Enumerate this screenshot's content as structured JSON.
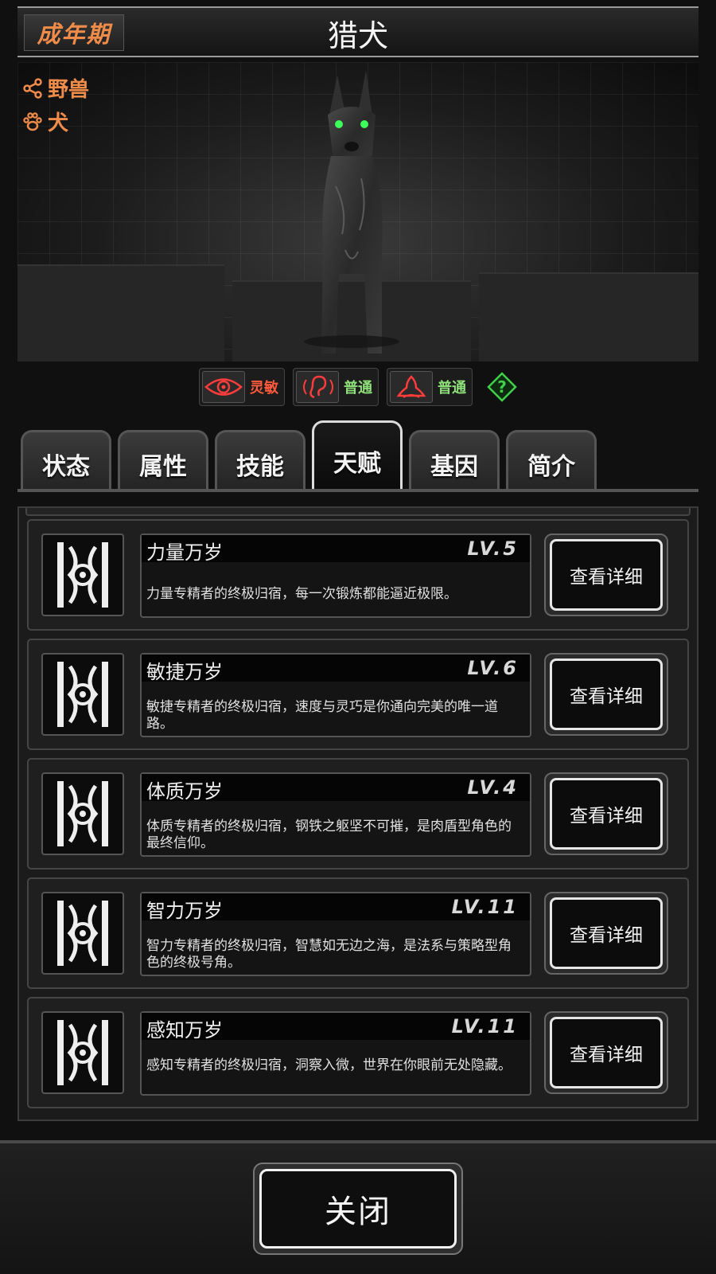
{
  "header": {
    "stage": "成年期",
    "name": "猎犬"
  },
  "portrait": {
    "class_tags": [
      {
        "icon": "share-icon",
        "label": "野兽"
      },
      {
        "icon": "paw-icon",
        "label": "犬"
      }
    ]
  },
  "senses": [
    {
      "icon": "eye-icon",
      "label": "灵敏",
      "color": "#ff5a3c"
    },
    {
      "icon": "ear-icon",
      "label": "普通",
      "color": "#8fe07a"
    },
    {
      "icon": "smell-icon",
      "label": "普通",
      "color": "#8fe07a"
    }
  ],
  "help_label": "?",
  "tabs": [
    {
      "label": "状态",
      "active": false
    },
    {
      "label": "属性",
      "active": false
    },
    {
      "label": "技能",
      "active": false
    },
    {
      "label": "天赋",
      "active": true
    },
    {
      "label": "基因",
      "active": false
    },
    {
      "label": "简介",
      "active": false
    }
  ],
  "talents": [
    {
      "name": "力量万岁",
      "level": "LV.5",
      "desc": "力量专精者的终极归宿，每一次锻炼都能逼近极限。",
      "button": "查看详细"
    },
    {
      "name": "敏捷万岁",
      "level": "LV.6",
      "desc": "敏捷专精者的终极归宿，速度与灵巧是你通向完美的唯一道路。",
      "button": "查看详细"
    },
    {
      "name": "体质万岁",
      "level": "LV.4",
      "desc": "体质专精者的终极归宿，钢铁之躯坚不可摧，是肉盾型角色的最终信仰。",
      "button": "查看详细"
    },
    {
      "name": "智力万岁",
      "level": "LV.11",
      "desc": "智力专精者的终极归宿，智慧如无边之海，是法系与策略型角色的终极号角。",
      "button": "查看详细"
    },
    {
      "name": "感知万岁",
      "level": "LV.11",
      "desc": "感知专精者的终极归宿，洞察入微，世界在你眼前无处隐藏。",
      "button": "查看详细"
    }
  ],
  "footer": {
    "close_label": "关闭"
  },
  "colors": {
    "accent_orange": "#f08c4a",
    "sense_red": "#ff5a3c",
    "sense_green": "#8fe07a",
    "help_green": "#3fd14a"
  }
}
